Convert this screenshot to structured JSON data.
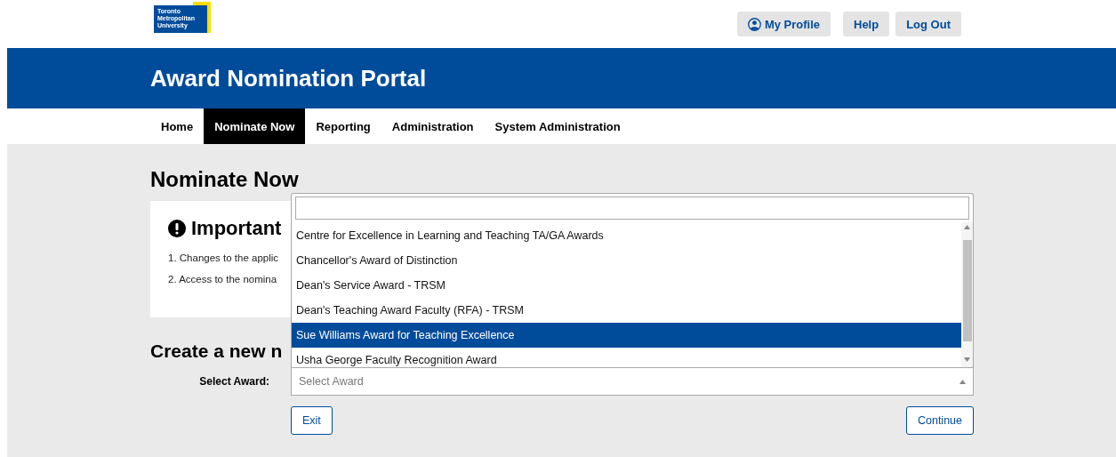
{
  "logo": {
    "lines": [
      "Toronto",
      "Metropolitan",
      "University"
    ]
  },
  "top_buttons": [
    {
      "label": "My Profile",
      "kind": "profile"
    },
    {
      "label": "Help",
      "kind": "plain"
    },
    {
      "label": "Log Out",
      "kind": "plain"
    }
  ],
  "portal_title": "Award Nomination Portal",
  "tabs": [
    {
      "label": "Home",
      "selected": false
    },
    {
      "label": "Nominate Now",
      "selected": true
    },
    {
      "label": "Reporting",
      "selected": false
    },
    {
      "label": "Administration",
      "selected": false
    },
    {
      "label": "System Administration",
      "selected": false
    }
  ],
  "page_title": "Nominate Now",
  "notice": {
    "title": "Important",
    "items": [
      "1. Changes to the applic",
      "2. Access to the nomina"
    ]
  },
  "section_heading": "Create a new n",
  "form": {
    "label": "Select Award:",
    "select": {
      "placeholder": "Select Award",
      "expanded": true
    },
    "dropdown": {
      "options": [
        {
          "label": "Centre for Excellence in Learning and Teaching TA/GA Awards",
          "selected": false
        },
        {
          "label": "Chancellor's Award of Distinction",
          "selected": false
        },
        {
          "label": "Dean's Service Award - TRSM",
          "selected": false
        },
        {
          "label": "Dean's Teaching Award Faculty (RFA) - TRSM",
          "selected": false
        },
        {
          "label": "Sue Williams Award for Teaching Excellence",
          "selected": true
        },
        {
          "label": "Usha George Faculty Recognition Award",
          "selected": false
        }
      ]
    }
  },
  "buttons": [
    {
      "label": "Exit"
    },
    {
      "label": "Continue"
    }
  ]
}
